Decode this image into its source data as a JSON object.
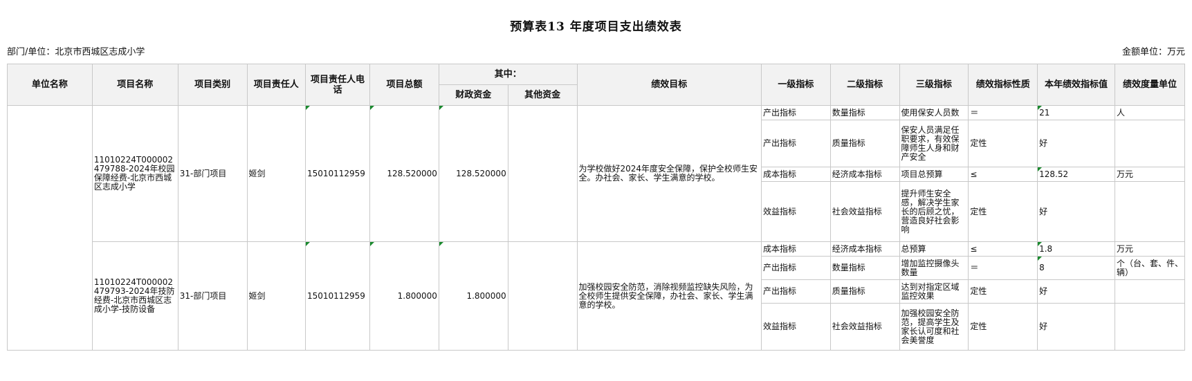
{
  "title": "预算表13 年度项目支出绩效表",
  "dept_label": "部门/单位：北京市西城区志成小学",
  "unit_label": "金额单位：万元",
  "headers": {
    "unit_name": "单位名称",
    "project_name": "项目名称",
    "project_type": "项目类别",
    "owner": "项目责任人",
    "owner_phone": "项目责任人电话",
    "total": "项目总额",
    "among": "其中：",
    "fiscal": "财政资金",
    "other": "其他资金",
    "goal": "绩效目标",
    "level1": "一级指标",
    "level2": "二级指标",
    "level3": "三级指标",
    "nature": "绩效指标性质",
    "value": "本年绩效指标值",
    "measure": "绩效度量单位"
  },
  "projects": [
    {
      "name": "11010224T000002479788-2024年校园保障经费-北京市西城区志成小学",
      "type": "31-部门项目",
      "owner": "姬剑",
      "phone": "15010112959",
      "total": "128.520000",
      "fiscal": "128.520000",
      "other": "",
      "goal": "为学校做好2024年度安全保障，保护全校师生安全。办社会、家长、学生满意的学校。",
      "indicators": [
        {
          "l1": "产出指标",
          "l2": "数量指标",
          "l3": "使用保安人员数",
          "nature": "＝",
          "value": "21",
          "unit": "人"
        },
        {
          "l1": "产出指标",
          "l2": "质量指标",
          "l3": "保安人员满足任职要求，有效保障师生人身和财产安全",
          "nature": "定性",
          "value": "好",
          "unit": ""
        },
        {
          "l1": "成本指标",
          "l2": "经济成本指标",
          "l3": "项目总预算",
          "nature": "≤",
          "value": "128.52",
          "unit": "万元"
        },
        {
          "l1": "效益指标",
          "l2": "社会效益指标",
          "l3": "提升师生安全感，解决学生家长的后顾之忧，营造良好社会影响",
          "nature": "定性",
          "value": "好",
          "unit": ""
        }
      ]
    },
    {
      "name": "11010224T000002479793-2024年技防经费-北京市西城区志成小学-技防设备",
      "type": "31-部门项目",
      "owner": "姬剑",
      "phone": "15010112959",
      "total": "1.800000",
      "fiscal": "1.800000",
      "other": "",
      "goal": "加强校园安全防范，消除视频监控缺失风险，为全校师生提供安全保障，办社会、家长、学生满意的学校。",
      "indicators": [
        {
          "l1": "成本指标",
          "l2": "经济成本指标",
          "l3": "总预算",
          "nature": "≤",
          "value": "1.8",
          "unit": "万元"
        },
        {
          "l1": "产出指标",
          "l2": "数量指标",
          "l3": "增加监控摄像头数量",
          "nature": "＝",
          "value": "8",
          "unit": "个（台、套、件、辆）"
        },
        {
          "l1": "产出指标",
          "l2": "质量指标",
          "l3": "达到对指定区域监控效果",
          "nature": "定性",
          "value": "好",
          "unit": ""
        },
        {
          "l1": "效益指标",
          "l2": "社会效益指标",
          "l3": "加强校园安全防范，提高学生及家长认可度和社会美誉度",
          "nature": "定性",
          "value": "好",
          "unit": ""
        }
      ]
    }
  ]
}
